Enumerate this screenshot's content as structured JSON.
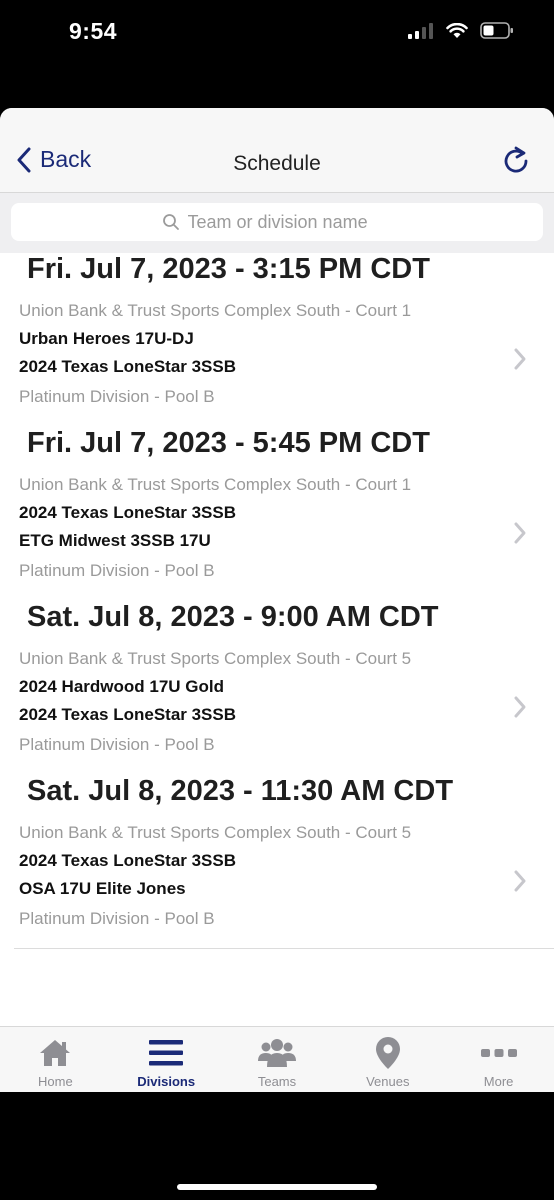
{
  "status_bar": {
    "time": "9:54"
  },
  "nav": {
    "back_label": "Back",
    "title": "Schedule"
  },
  "search": {
    "placeholder": "Team or division name",
    "value": ""
  },
  "colors": {
    "accent": "#1b2a77",
    "muted": "#9a9a9a",
    "tab_inactive": "#8e8e93"
  },
  "games": [
    {
      "date": "Fri. Jul 7, 2023 - 3:15 PM CDT",
      "venue": "Union Bank & Trust Sports Complex South - Court 1",
      "team1": "Urban Heroes 17U-DJ",
      "team2": "2024 Texas LoneStar 3SSB",
      "division": "Platinum Division - Pool B"
    },
    {
      "date": "Fri. Jul 7, 2023 - 5:45 PM CDT",
      "venue": "Union Bank & Trust Sports Complex South - Court 1",
      "team1": "2024 Texas LoneStar 3SSB",
      "team2": "ETG Midwest 3SSB 17U",
      "division": "Platinum Division - Pool B"
    },
    {
      "date": "Sat. Jul 8, 2023 - 9:00 AM CDT",
      "venue": "Union Bank & Trust Sports Complex South - Court 5",
      "team1": "2024 Hardwood 17U Gold",
      "team2": "2024 Texas LoneStar 3SSB",
      "division": "Platinum Division - Pool B"
    },
    {
      "date": "Sat. Jul 8, 2023 - 11:30 AM CDT",
      "venue": "Union Bank & Trust Sports Complex South - Court 5",
      "team1": "2024 Texas LoneStar 3SSB",
      "team2": "OSA 17U Elite Jones",
      "division": "Platinum Division - Pool B"
    }
  ],
  "tabs": [
    {
      "label": "Home",
      "icon": "home-icon",
      "active": false
    },
    {
      "label": "Divisions",
      "icon": "menu-icon",
      "active": true
    },
    {
      "label": "Teams",
      "icon": "people-icon",
      "active": false
    },
    {
      "label": "Venues",
      "icon": "location-pin-icon",
      "active": false
    },
    {
      "label": "More",
      "icon": "ellipsis-icon",
      "active": false
    }
  ]
}
